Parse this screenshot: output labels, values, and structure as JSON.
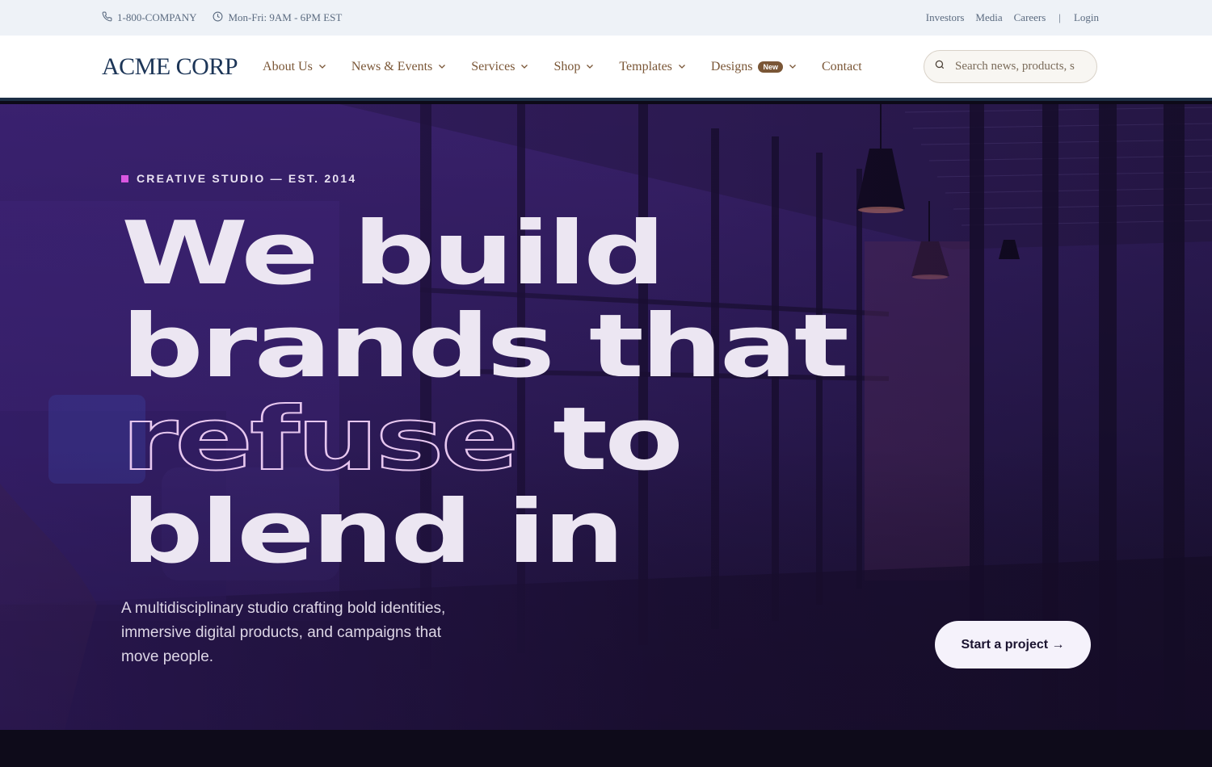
{
  "topbar": {
    "phone": "1-800-COMPANY",
    "hours": "Mon-Fri: 9AM - 6PM EST",
    "links": [
      "Investors",
      "Media",
      "Careers"
    ],
    "separator": "|",
    "login": "Login",
    "icons": [
      "phone-icon",
      "clock-icon"
    ]
  },
  "nav": {
    "logo": "ACME CORP",
    "items": [
      {
        "label": "About Us",
        "dropdown": true
      },
      {
        "label": "News & Events",
        "dropdown": true
      },
      {
        "label": "Services",
        "dropdown": true
      },
      {
        "label": "Shop",
        "dropdown": true
      },
      {
        "label": "Templates",
        "dropdown": true
      },
      {
        "label": "Designs",
        "dropdown": true,
        "badge": "New"
      },
      {
        "label": "Contact",
        "dropdown": false
      }
    ],
    "search_placeholder": "Search news, products, s"
  },
  "hero": {
    "eyebrow": "CREATIVE STUDIO — EST. 2014",
    "headline": {
      "line1": "We build",
      "line2": "brands that",
      "line3_outline": "refuse",
      "line3_rest": " to",
      "line4": "blend in"
    },
    "subtext": "A multidisciplinary studio crafting bold identities, immersive digital products, and campaigns that move people.",
    "cta": "Start a project →"
  },
  "colors": {
    "topbar_bg": "#eef2f7",
    "nav_text": "#7a5636",
    "logo": "#1c3557",
    "accent": "#d957e0",
    "hero_text": "#ece6f2"
  }
}
